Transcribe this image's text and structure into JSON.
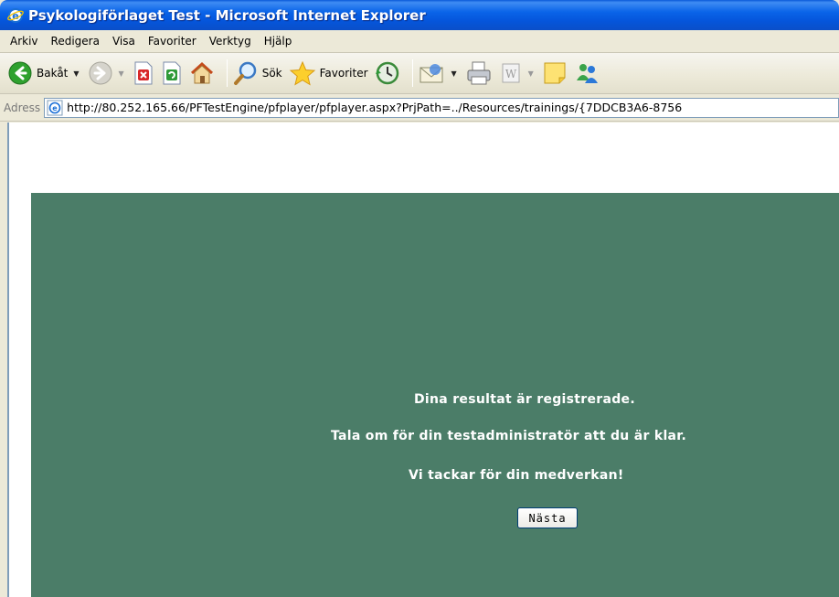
{
  "window": {
    "title": "Psykologiförlaget Test - Microsoft Internet Explorer"
  },
  "menu": {
    "items": [
      "Arkiv",
      "Redigera",
      "Visa",
      "Favoriter",
      "Verktyg",
      "Hjälp"
    ]
  },
  "toolbar": {
    "back_label": "Bakåt",
    "search_label": "Sök",
    "favorites_label": "Favoriter"
  },
  "address": {
    "label": "Adress",
    "url": "http://80.252.165.66/PFTestEngine/pfplayer/pfplayer.aspx?PrjPath=../Resources/trainings/{7DDCB3A6-8756"
  },
  "page": {
    "line1": "Dina resultat är registrerade.",
    "line2": "Tala om för din testadministratör att du är klar.",
    "line3": "Vi tackar för din medverkan!",
    "next_button": "Nästa"
  },
  "colors": {
    "panel_bg": "#4b7d68",
    "titlebar": "#0a5ad9"
  }
}
